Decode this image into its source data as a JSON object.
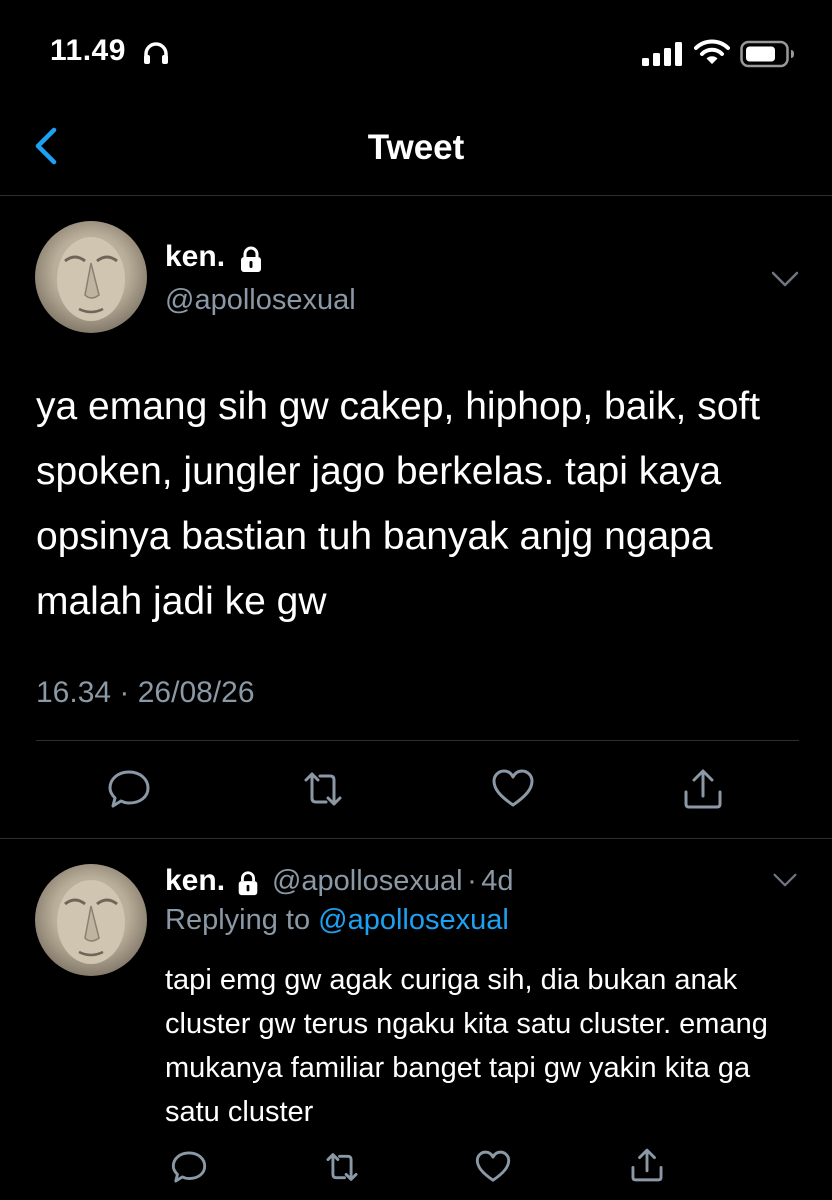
{
  "status_bar": {
    "time": "11.49"
  },
  "nav": {
    "title": "Tweet"
  },
  "main_tweet": {
    "author_name": "ken.",
    "handle": "@apollosexual",
    "text": "ya emang sih gw cakep, hiphop, baik, soft spoken, jungler jago berkelas. tapi kaya opsinya bastian tuh banyak anjg ngapa malah jadi ke gw",
    "time": "16.34 · 26/08/26"
  },
  "reply_tweet": {
    "author_name": "ken.",
    "handle": "@apollosexual",
    "age": "4d",
    "replying_prefix": "Replying to",
    "replying_to": "@apollosexual",
    "text": "tapi emg gw agak curiga sih, dia bukan anak cluster gw terus ngaku kita satu cluster. emang mukanya familiar banget tapi gw yakin kita ga satu cluster"
  },
  "colors": {
    "background": "#000000",
    "accent": "#1da1f2",
    "muted": "#8b98a5"
  }
}
